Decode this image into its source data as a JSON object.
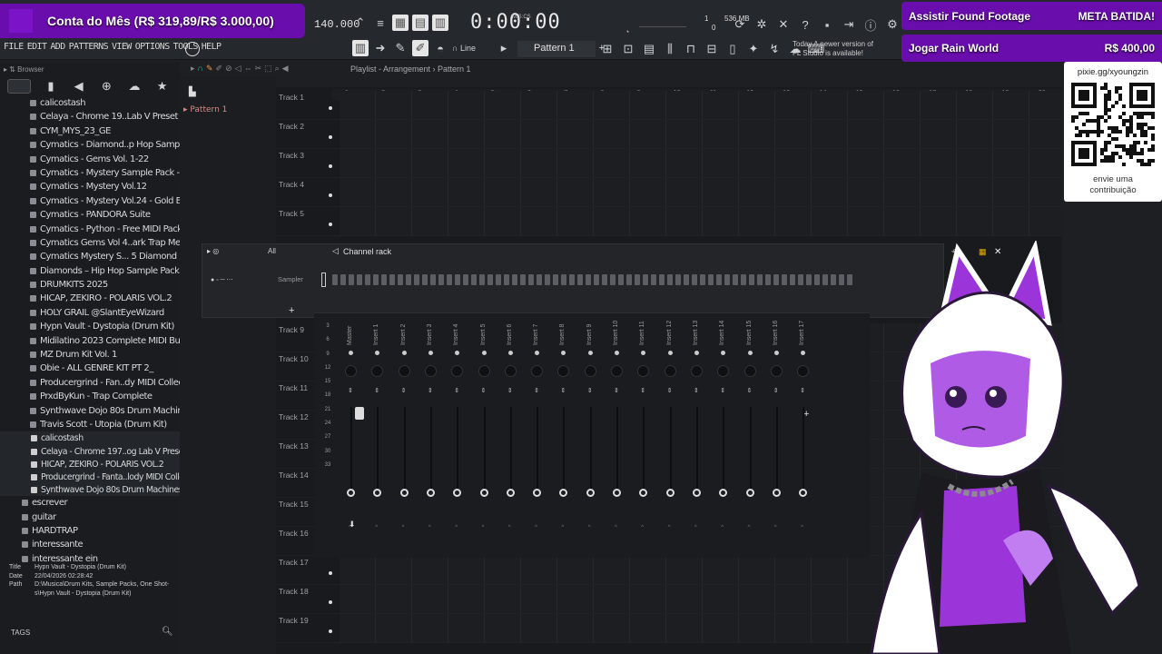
{
  "overlay": {
    "goal_label": "Conta do Mês (R$ 319,89/R$ 3.000,00)",
    "alerts": [
      {
        "left": "Assistir Found Footage",
        "right": "META BATIDA!"
      },
      {
        "left": "Jogar Rain World",
        "right": "R$ 400,00"
      }
    ],
    "qr": {
      "url": "pixie.gg/xyoungzin",
      "caption_line1": "envie uma",
      "caption_line2": "contribuição"
    },
    "accent_color": "#6a0dad"
  },
  "fl": {
    "menu": [
      "FILE",
      "EDIT",
      "ADD",
      "PATTERNS",
      "VIEW",
      "OPTIONS",
      "TOOLS",
      "HELP"
    ],
    "tempo": "140.000",
    "time": "0:00:00",
    "time_unit": "M:S:CS",
    "cpu_top": "1",
    "memory": "536 MB",
    "cpu_bottom": "0",
    "snap_label": "Line",
    "pattern_label": "Pattern 1",
    "update_line1": "Today  A newer version of",
    "update_line2": "FL Studio is available!",
    "playlist_breadcrumb": "Playlist - Arrangement › Pattern 1",
    "pattern_item": "Pattern 1",
    "ruler_numbers": [
      "1",
      "2",
      "3",
      "4",
      "5",
      "6",
      "7",
      "8",
      "9",
      "10",
      "11",
      "12",
      "13",
      "14",
      "15",
      "16",
      "17",
      "18",
      "19",
      "20"
    ],
    "tracks": [
      "Track 1",
      "Track 2",
      "Track 3",
      "Track 4",
      "Track 5",
      "Track 9",
      "Track 10",
      "Track 11",
      "Track 12",
      "Track 13",
      "Track 14",
      "Track 15",
      "Track 16",
      "Track 17",
      "Track 18",
      "Track 19"
    ],
    "channel_rack": {
      "title": "Channel rack",
      "filter": "All",
      "channel": "Sampler"
    },
    "mixer_levels": [
      "3",
      "6",
      "9",
      "12",
      "15",
      "18",
      "21",
      "24",
      "27",
      "30",
      "33"
    ],
    "mixer_strips": [
      "Master",
      "Insert 1",
      "Insert 2",
      "Insert 3",
      "Insert 4",
      "Insert 5",
      "Insert 6",
      "Insert 7",
      "Insert 8",
      "Insert 9",
      "Insert 10",
      "Insert 11",
      "Insert 12",
      "Insert 13",
      "Insert 14",
      "Insert 15",
      "Insert 16",
      "Insert 17"
    ]
  },
  "browser": {
    "title": "Browser",
    "folders": [
      "calicostash",
      "Celaya - Chrome 19..Lab V Preset Bank)",
      "CYM_MYS_23_GE",
      "Cymatics - Diamond..p Hop Sample Pack",
      "Cymatics - Gems Vol. 1-22",
      "Cymatics - Mystery Sample Pack - Vol 4",
      "Cymatics - Mystery Vol.12",
      "Cymatics - Mystery Vol.24 - Gold Edition",
      "Cymatics - PANDORA Suite",
      "Cymatics - Python - Free MIDI Pack",
      "Cymatics Gems Vol 4..ark Trap Melodies",
      "Cymatics Mystery S... 5 Diamond Edition",
      "Diamonds – Hip Hop Sample Pack",
      "DRUMKITS 2025",
      "HICAP, ZEKIRO - POLARIS VOL.2",
      "HOLY GRAIL @SlantEyeWizard",
      "Hypn Vault - Dystopia (Drum Kit)",
      "Midilatino 2023 Complete MIDI Bundle",
      "MZ Drum Kit Vol. 1",
      "Obie - ALL GENRE KIT PT 2_",
      "Producergrind - Fan..dy MIDI Collection",
      "PrxdByKun - Trap Complete",
      "Synthwave Dojo 80s Drum Machines",
      "Travis Scott - Utopia (Drum Kit)"
    ],
    "recent": [
      "calicostash",
      "Celaya - Chrome 197..og Lab V Preset Bank)",
      "HICAP, ZEKIRO - POLARIS VOL.2",
      "Producergrind - Fanta..lody MIDI Collection",
      "Synthwave Dojo 80s Drum Machines"
    ],
    "root_folders": [
      "escrever",
      "guitar",
      "HARDTRAP",
      "interessante",
      "interessante ein"
    ],
    "info": {
      "title_label": "Title",
      "title": "Hypn Vault - Dystopia (Drum Kit)",
      "date_label": "Date",
      "date": "22/04/2026 02:28:42",
      "path_label": "Path",
      "path1": "D:\\Musica\\Drum Kits, Sample Packs, One Shot-",
      "path2": "s\\Hypn Vault - Dystopia (Drum Kit)"
    },
    "tags_label": "TAGS"
  }
}
